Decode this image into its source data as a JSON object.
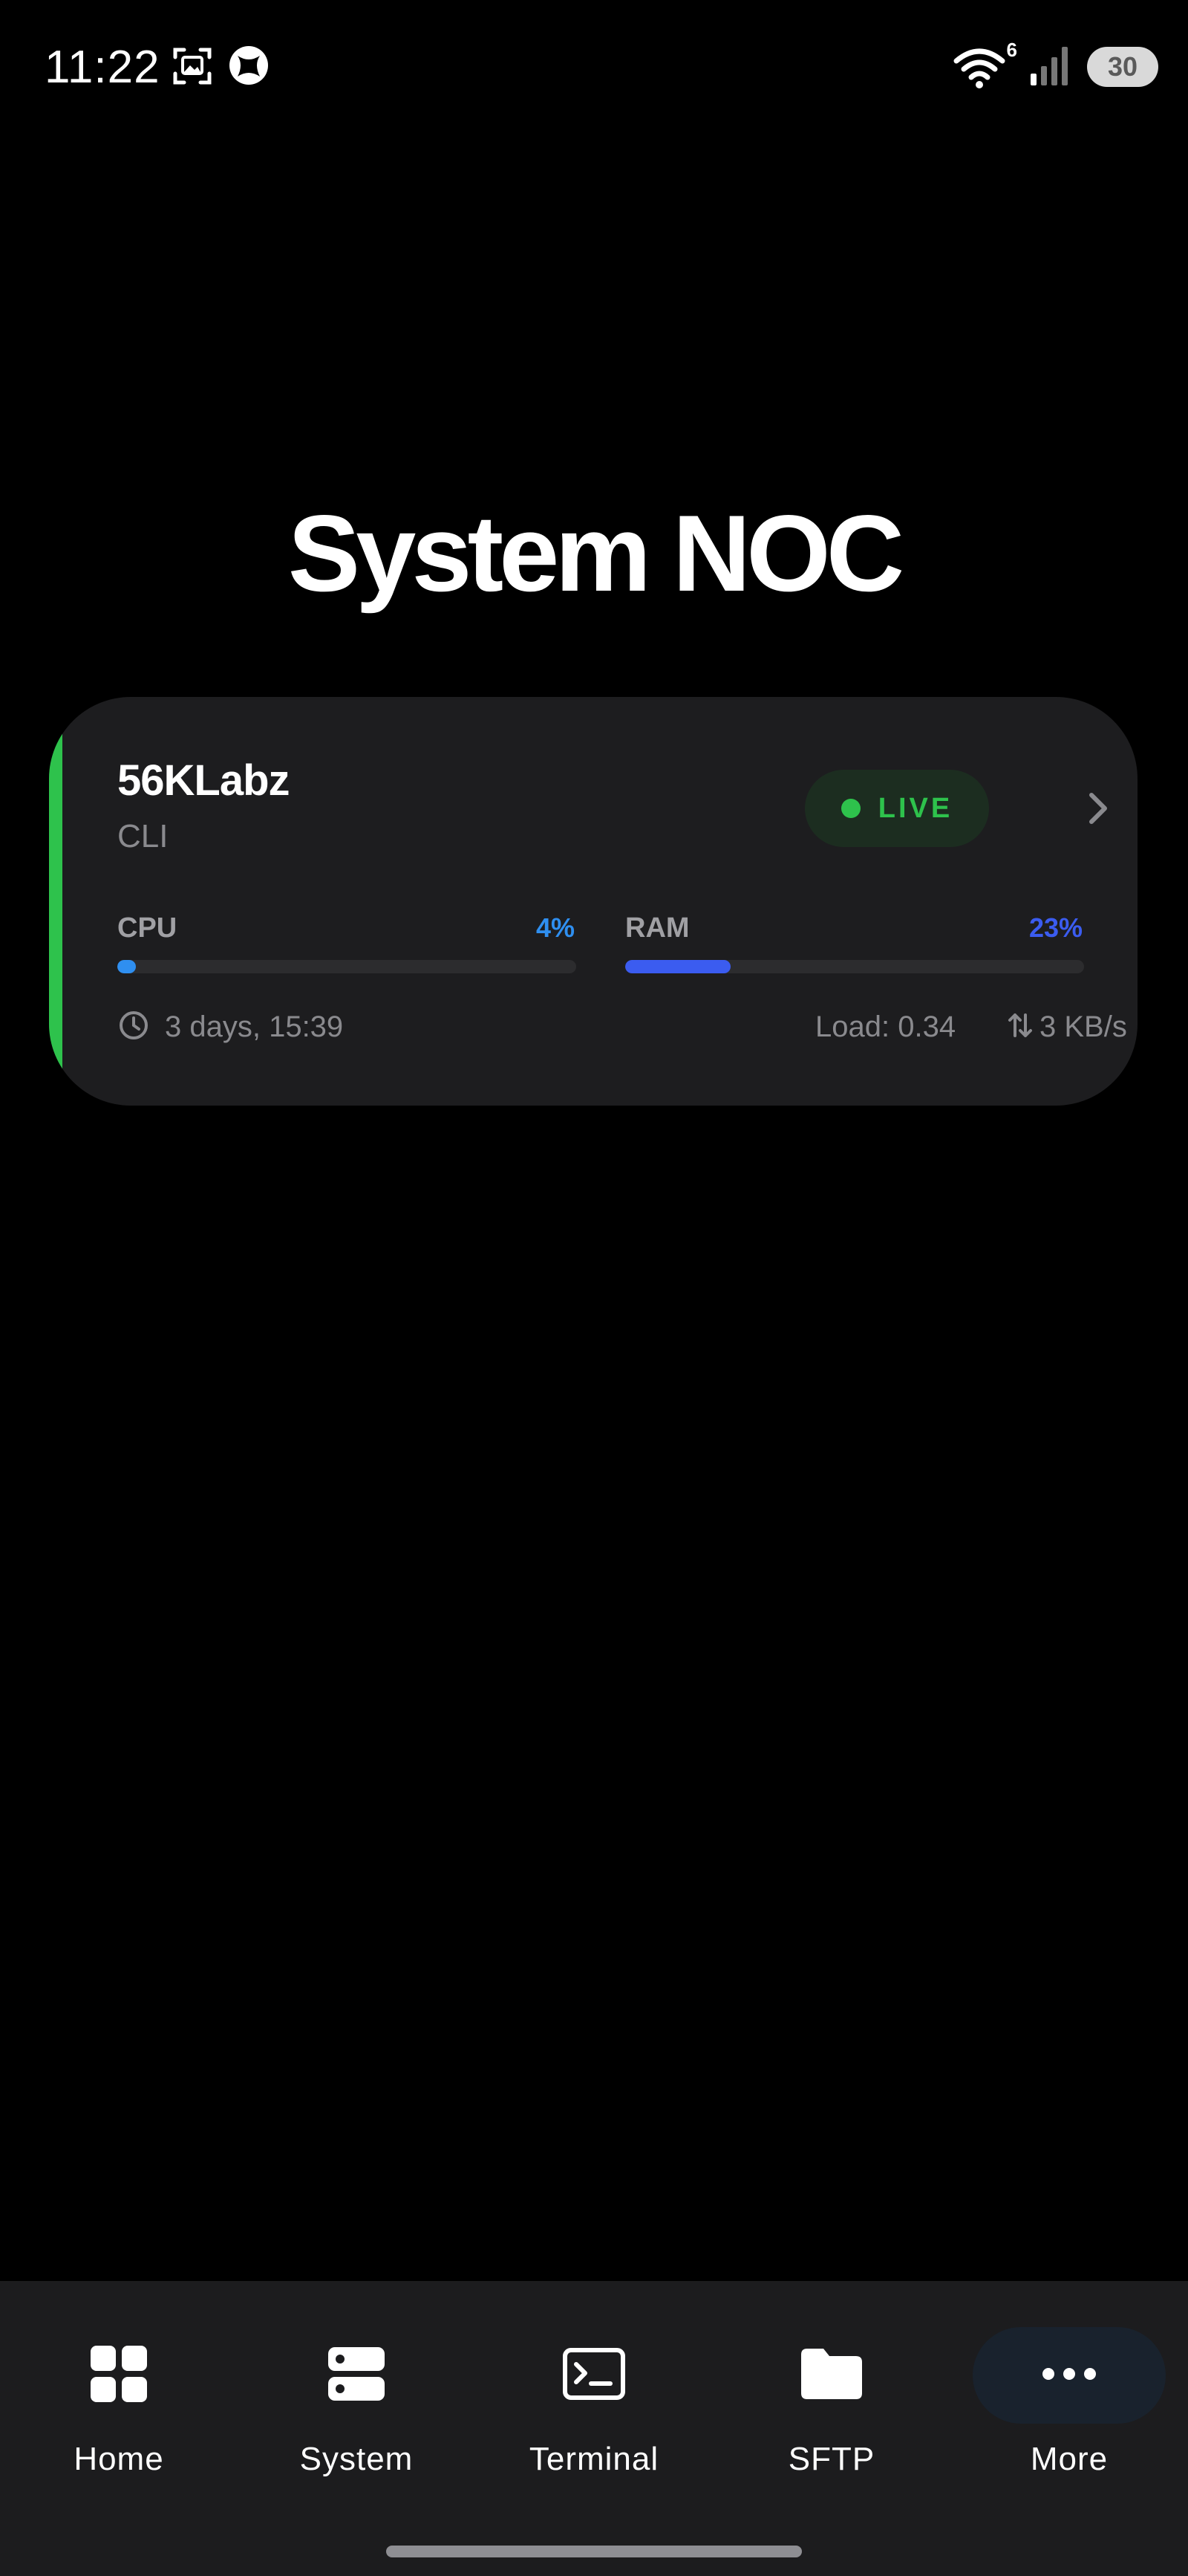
{
  "status_bar": {
    "time": "11:22",
    "wifi_badge": "6",
    "battery": "30",
    "left_icons": [
      "screenshot-icon",
      "xbox-icon"
    ],
    "right_icons": [
      "wifi-icon",
      "signal-icon",
      "battery-icon"
    ]
  },
  "page": {
    "title": "System NOC"
  },
  "server_card": {
    "name": "56KLabz",
    "type": "CLI",
    "status_label": "LIVE",
    "accent_color": "#2ec24c",
    "cpu": {
      "label": "CPU",
      "value_text": "4%",
      "fraction": 0.04,
      "color": "#2f8ff0"
    },
    "ram": {
      "label": "RAM",
      "value_text": "23%",
      "fraction": 0.23,
      "color": "#3b5cf0"
    },
    "uptime": "3 days, 15:39",
    "load": "Load: 0.34",
    "network": "3 KB/s"
  },
  "bottom_nav": {
    "items": [
      {
        "label": "Home",
        "icon": "grid-icon",
        "active": false
      },
      {
        "label": "System",
        "icon": "server-icon",
        "active": false
      },
      {
        "label": "Terminal",
        "icon": "terminal-icon",
        "active": false
      },
      {
        "label": "SFTP",
        "icon": "folder-icon",
        "active": false
      },
      {
        "label": "More",
        "icon": "more-icon",
        "active": true
      }
    ]
  }
}
